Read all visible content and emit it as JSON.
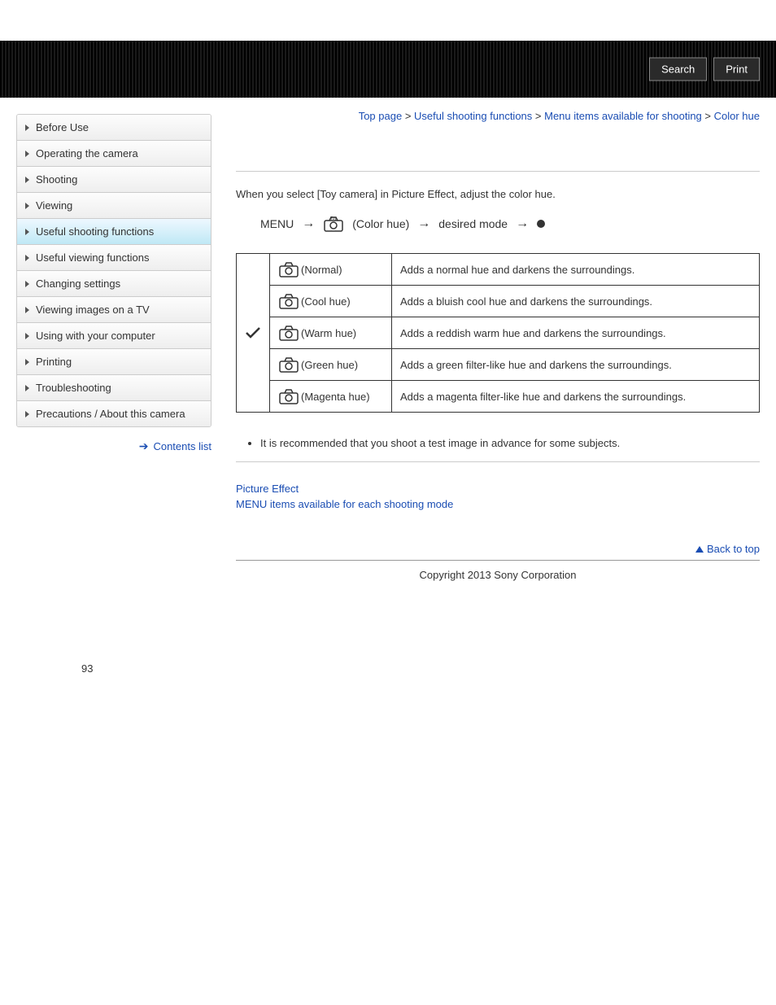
{
  "header": {
    "search": "Search",
    "print": "Print"
  },
  "breadcrumb": {
    "top": "Top page",
    "s1": "Useful shooting functions",
    "s2": "Menu items available for shooting",
    "cur": "Color hue",
    "sep": " > "
  },
  "nav": {
    "items": [
      "Before Use",
      "Operating the camera",
      "Shooting",
      "Viewing",
      "Useful shooting functions",
      "Useful viewing functions",
      "Changing settings",
      "Viewing images on a TV",
      "Using with your computer",
      "Printing",
      "Troubleshooting",
      "Precautions / About this camera"
    ],
    "contents": "Contents list"
  },
  "intro": "When you select [Toy camera] in Picture Effect, adjust the color hue.",
  "menu_path": {
    "menu": "MENU",
    "label": "(Color hue)",
    "desired": "desired mode"
  },
  "table": {
    "rows": [
      {
        "check": true,
        "name": "(Normal)",
        "desc": "Adds a normal hue and darkens the surroundings."
      },
      {
        "check": false,
        "name": "(Cool hue)",
        "desc": "Adds a bluish cool hue and darkens the surroundings."
      },
      {
        "check": false,
        "name": "(Warm hue)",
        "desc": "Adds a reddish warm hue and darkens the surroundings."
      },
      {
        "check": false,
        "name": "(Green hue)",
        "desc": "Adds a green filter-like hue and darkens the surroundings."
      },
      {
        "check": false,
        "name": "(Magenta hue)",
        "desc": "Adds a magenta filter-like hue and darkens the surroundings."
      }
    ]
  },
  "note": "It is recommended that you shoot a test image in advance for some subjects.",
  "related": {
    "l1": "Picture Effect",
    "l2": "MENU items available for each shooting mode"
  },
  "btt": "Back to top",
  "copy": "Copyright 2013 Sony Corporation",
  "pnum": "93"
}
